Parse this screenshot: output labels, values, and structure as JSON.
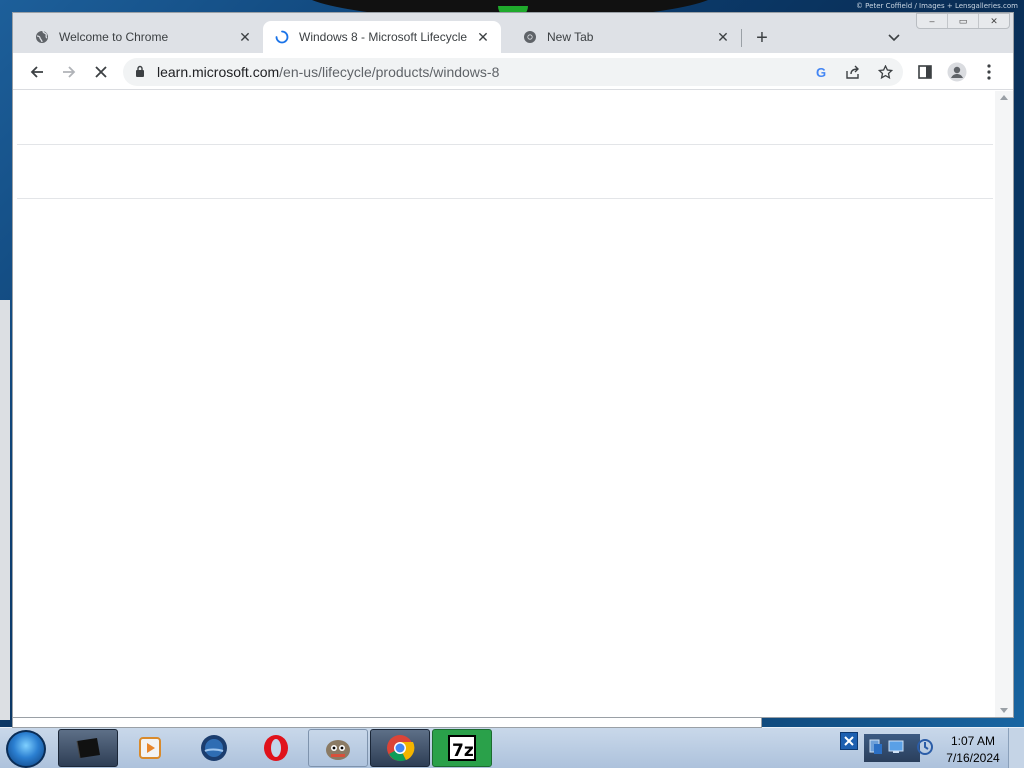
{
  "wallpaper": {
    "credit": "© Peter Coffield / Images + Lensgalleries.com"
  },
  "browser": {
    "tabs": [
      {
        "title": "Welcome to Chrome",
        "favicon": "globe-icon",
        "close": "✕"
      },
      {
        "title": "Windows 8 - Microsoft Lifecycle",
        "favicon": "loading-spinner-icon",
        "close": "✕",
        "active": true
      },
      {
        "title": "New Tab",
        "favicon": "chrome-icon",
        "close": "✕"
      }
    ],
    "new_tab": "+",
    "caption": {
      "minimize": "–",
      "restore": "▭",
      "close": "✕"
    },
    "toolbar": {
      "url_host": "learn.microsoft.com",
      "url_path": "/en-us/lifecycle/products/windows-8",
      "google_lens_glyph": "G"
    }
  },
  "colors": {
    "accent": "#1a73e8",
    "tab_strip": "#dee1e6",
    "taskbar": "#b7c9df"
  },
  "taskbar": {
    "pinned": [
      "terminal-icon",
      "media-player-icon",
      "thunderbird-icon",
      "opera-icon",
      "gimp-icon",
      "chrome-icon",
      "7zip-icon"
    ],
    "tray_icons": [
      "action-center-icon",
      "network-icon",
      "display-icon",
      "update-icon"
    ],
    "time": "1:07 AM",
    "date": "7/16/2024"
  }
}
